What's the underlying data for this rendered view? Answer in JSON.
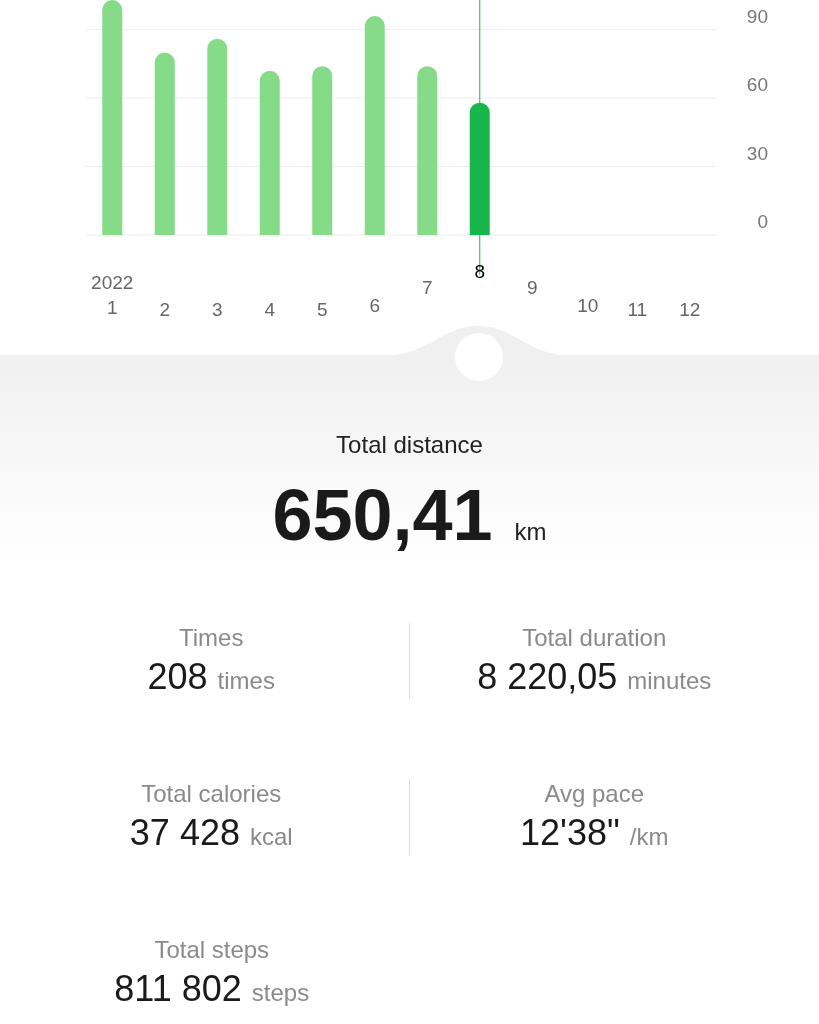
{
  "chart": {
    "chart_data": {
      "type": "bar",
      "grid": true,
      "values": [
        103,
        80,
        86,
        72,
        74,
        96,
        74,
        58,
        null,
        null,
        null,
        null
      ],
      "ylim": [
        0,
        103
      ],
      "yticks": [
        0,
        30,
        60,
        90
      ]
    }
  },
  "year": "2022",
  "months": [
    {
      "label": "1",
      "selected": false
    },
    {
      "label": "2",
      "selected": false
    },
    {
      "label": "3",
      "selected": false
    },
    {
      "label": "4",
      "selected": false
    },
    {
      "label": "5",
      "selected": false
    },
    {
      "label": "6",
      "selected": false
    },
    {
      "label": "7",
      "selected": false
    },
    {
      "label": "8",
      "selected": true
    },
    {
      "label": "9",
      "selected": false
    },
    {
      "label": "10",
      "selected": false
    },
    {
      "label": "11",
      "selected": false
    },
    {
      "label": "12",
      "selected": false
    }
  ],
  "total": {
    "label": "Total distance",
    "value": "650,41",
    "unit": "km"
  },
  "stats": [
    {
      "label": "Times",
      "value": "208",
      "unit": "times"
    },
    {
      "label": "Total duration",
      "value": "8 220,05",
      "unit": "minutes"
    },
    {
      "label": "Total calories",
      "value": "37 428",
      "unit": "kcal"
    },
    {
      "label": "Avg pace",
      "value": "12'38\"",
      "unit": "/km"
    },
    {
      "label": "Total steps",
      "value": "811 802",
      "unit": "steps"
    }
  ]
}
